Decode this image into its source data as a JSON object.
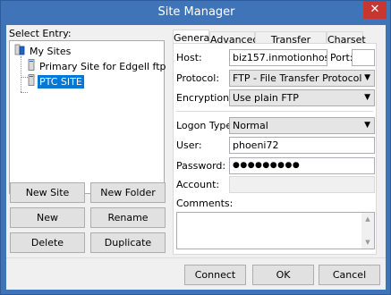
{
  "window": {
    "title": "Site Manager",
    "close_glyph": "✕"
  },
  "tree": {
    "label": "Select Entry:",
    "root": "My Sites",
    "items": [
      {
        "label": "Primary Site for Edgell ftp"
      },
      {
        "label": "PTC SITE",
        "selected": true
      }
    ]
  },
  "left_buttons": {
    "new_site": "New Site",
    "new_folder": "New Folder",
    "new_bookmark": "New Bookmark",
    "rename": "Rename",
    "delete": "Delete",
    "duplicate": "Duplicate"
  },
  "tabs": [
    "General",
    "Advanced",
    "Transfer Settings",
    "Charset"
  ],
  "general": {
    "host_label": "Host:",
    "host_value": "biz157.inmotionhosting.",
    "port_label": "Port:",
    "port_value": "",
    "protocol_label": "Protocol:",
    "protocol_value": "FTP - File Transfer Protocol",
    "encryption_label": "Encryption:",
    "encryption_value": "Use plain FTP",
    "logon_label": "Logon Type:",
    "logon_value": "Normal",
    "user_label": "User:",
    "user_value": "phoeni72",
    "password_label": "Password:",
    "password_value": "●●●●●●●●●",
    "account_label": "Account:",
    "account_value": "",
    "comments_label": "Comments:"
  },
  "footer": {
    "connect": "Connect",
    "ok": "OK",
    "cancel": "Cancel"
  },
  "colors": {
    "titlebar": "#3f74b9",
    "close": "#c7372f",
    "selection": "#0078d7"
  }
}
